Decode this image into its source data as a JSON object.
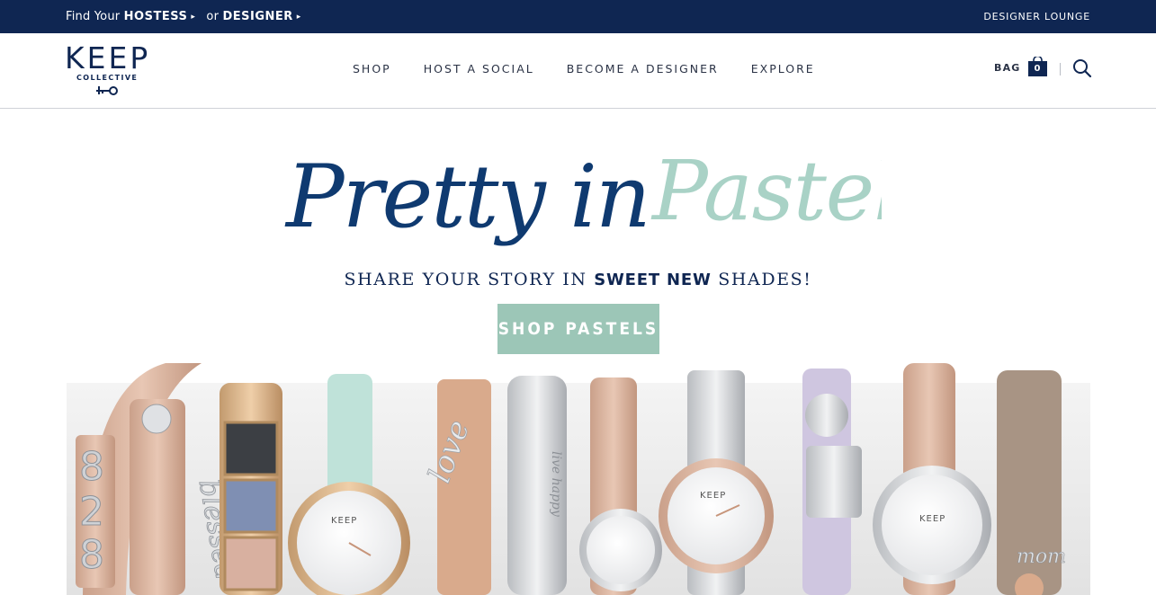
{
  "topbar": {
    "find_prefix": "Find Your",
    "hostess": "HOSTESS",
    "or_text": "or",
    "designer": "DESIGNER",
    "arrow": "▸",
    "designer_lounge": "DESIGNER LOUNGE"
  },
  "logo": {
    "word": "KEEP",
    "sub": "COLLECTIVE"
  },
  "nav": {
    "items": [
      "SHOP",
      "HOST A SOCIAL",
      "BECOME A DESIGNER",
      "EXPLORE"
    ]
  },
  "bag": {
    "label": "BAG",
    "count": "0"
  },
  "hero": {
    "title_part1": "Pretty in",
    "title_part2": "Pastel",
    "tagline_start": "SHARE YOUR STORY IN",
    "tagline_bold": "SWEET NEW",
    "tagline_end": "SHADES!",
    "cta": "SHOP PASTELS"
  },
  "product_engravings": {
    "bangle": "live happy",
    "charm_word": "love",
    "charm_mom": "mom",
    "charm_bless": "blessed",
    "watch_brand": "KEEP"
  },
  "colors": {
    "navy": "#0f2652",
    "mint": "#9cc6b7",
    "rose_gold": "#d9a98a",
    "lavender": "#cfc6e0"
  }
}
